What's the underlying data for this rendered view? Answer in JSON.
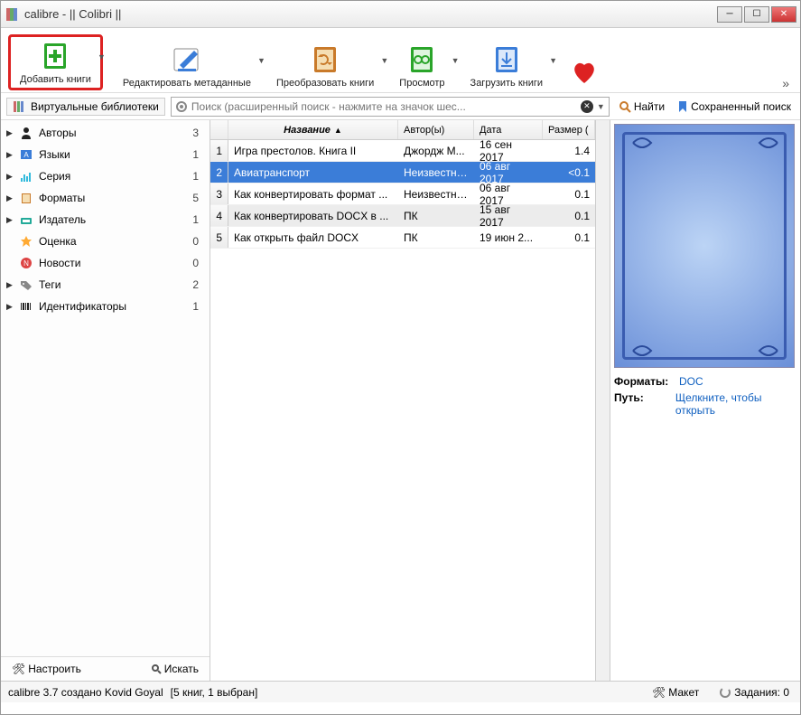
{
  "window": {
    "title": "calibre - || Colibri ||"
  },
  "toolbar": {
    "add": "Добавить книги",
    "edit": "Редактировать метаданные",
    "convert": "Преобразовать книги",
    "view": "Просмотр",
    "download": "Загрузить книги"
  },
  "searchbar": {
    "vlib": "Виртуальные библиотеки",
    "placeholder": "Поиск (расширенный поиск - нажмите на значок шес...",
    "find": "Найти",
    "saved": "Сохраненный поиск"
  },
  "tree": [
    {
      "icon": "person",
      "label": "Авторы",
      "count": "3",
      "arrow": true
    },
    {
      "icon": "lang",
      "label": "Языки",
      "count": "1",
      "arrow": true
    },
    {
      "icon": "series",
      "label": "Серия",
      "count": "1",
      "arrow": true
    },
    {
      "icon": "book",
      "label": "Форматы",
      "count": "5",
      "arrow": true
    },
    {
      "icon": "typewriter",
      "label": "Издатель",
      "count": "1",
      "arrow": true
    },
    {
      "icon": "star",
      "label": "Оценка",
      "count": "0",
      "arrow": false
    },
    {
      "icon": "news",
      "label": "Новости",
      "count": "0",
      "arrow": false
    },
    {
      "icon": "tag",
      "label": "Теги",
      "count": "2",
      "arrow": true
    },
    {
      "icon": "barcode",
      "label": "Идентификаторы",
      "count": "1",
      "arrow": true
    }
  ],
  "sidefoot": {
    "config": "Настроить",
    "search": "Искать"
  },
  "columns": {
    "title": "Название",
    "author": "Автор(ы)",
    "date": "Дата",
    "size": "Размер ("
  },
  "rows": [
    {
      "n": "1",
      "title": "Игра престолов. Книга II",
      "author": "Джордж М...",
      "date": "16 сен 2017",
      "size": "1.4",
      "sel": false,
      "alt": false
    },
    {
      "n": "2",
      "title": "Авиатранспорт",
      "author": "Неизвестный",
      "date": "06 авг 2017",
      "size": "<0.1",
      "sel": true,
      "alt": false
    },
    {
      "n": "3",
      "title": "Как конвертировать формат ...",
      "author": "Неизвестный",
      "date": "06 авг 2017",
      "size": "0.1",
      "sel": false,
      "alt": false
    },
    {
      "n": "4",
      "title": "Как конвертировать DOCX в ...",
      "author": "ПК",
      "date": "15 авг 2017",
      "size": "0.1",
      "sel": false,
      "alt": true
    },
    {
      "n": "5",
      "title": "Как открыть файл DOCX",
      "author": "ПК",
      "date": "19 июн 2...",
      "size": "0.1",
      "sel": false,
      "alt": false
    }
  ],
  "details": {
    "formats_label": "Форматы:",
    "formats_value": "DOC",
    "path_label": "Путь:",
    "path_value": "Щелкните, чтобы открыть"
  },
  "status": {
    "left": "calibre 3.7 создано Kovid Goyal",
    "count": "[5 книг, 1 выбран]",
    "layout": "Макет",
    "jobs": "Задания: 0"
  }
}
